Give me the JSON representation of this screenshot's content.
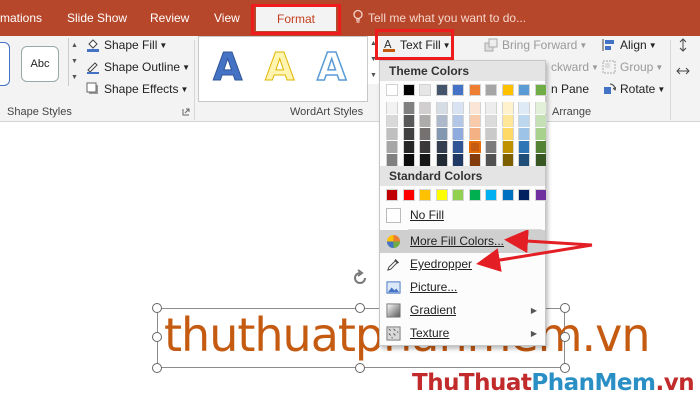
{
  "tabs": {
    "animations": "mations",
    "slide_show": "Slide Show",
    "review": "Review",
    "view": "View",
    "format": "Format",
    "tell_me": "Tell me what you want to do..."
  },
  "ribbon": {
    "shape_styles": {
      "thumb_label": "Abc",
      "shape_fill": "Shape Fill",
      "shape_outline": "Shape Outline",
      "shape_effects": "Shape Effects",
      "group_label": "Shape Styles"
    },
    "wordart": {
      "letter": "A",
      "text_fill": "Text Fill",
      "group_label": "WordArt Styles"
    },
    "arrange": {
      "bring_forward": "Bring Forward",
      "send_backward": "ckward",
      "selection_pane": "n Pane",
      "align": "Align",
      "group": "Group",
      "rotate": "Rotate",
      "group_label": "Arrange"
    }
  },
  "menu": {
    "theme_colors_label": "Theme Colors",
    "standard_colors_label": "Standard Colors",
    "theme_top": [
      "#ffffff",
      "#000000",
      "#e7e6e6",
      "#44546a",
      "#4472c4",
      "#ed7d31",
      "#a5a5a5",
      "#ffc000",
      "#5b9bd5",
      "#70ad47"
    ],
    "theme_shades": [
      [
        "#f2f2f2",
        "#808080",
        "#d0cece",
        "#d6dce4",
        "#dae3f3",
        "#fbe5d6",
        "#ededed",
        "#fff2cc",
        "#deebf7",
        "#e2f0d9"
      ],
      [
        "#d9d9d9",
        "#595959",
        "#aeabab",
        "#adb9ca",
        "#b4c7e7",
        "#f8cbad",
        "#dbdbdb",
        "#ffe699",
        "#bdd7ee",
        "#c5e0b4"
      ],
      [
        "#bfbfbf",
        "#404040",
        "#757171",
        "#8497b0",
        "#8faadc",
        "#f4b183",
        "#c9c9c9",
        "#ffd966",
        "#9dc3e6",
        "#a9d18e"
      ],
      [
        "#a6a6a6",
        "#262626",
        "#3a3838",
        "#333f50",
        "#2f5597",
        "#c55a11",
        "#7b7b7b",
        "#bf9000",
        "#2e75b6",
        "#548235"
      ],
      [
        "#808080",
        "#0d0d0d",
        "#171616",
        "#222a35",
        "#203864",
        "#843c0c",
        "#525252",
        "#7f6000",
        "#1f4e79",
        "#385723"
      ]
    ],
    "standard": [
      "#c00000",
      "#ff0000",
      "#ffc000",
      "#ffff00",
      "#92d050",
      "#00b050",
      "#00b0f0",
      "#0070c0",
      "#002060",
      "#7030a0"
    ],
    "no_fill": "No Fill",
    "more_fill_colors": "More Fill Colors...",
    "eyedropper": "Eyedropper",
    "picture": "Picture...",
    "gradient": "Gradient",
    "texture": "Texture"
  },
  "slide": {
    "text": "thuthuatphanmem.vn"
  },
  "watermark": {
    "part1": "ThuThuat",
    "part2": "PhanMem",
    "part3": ".vn"
  }
}
